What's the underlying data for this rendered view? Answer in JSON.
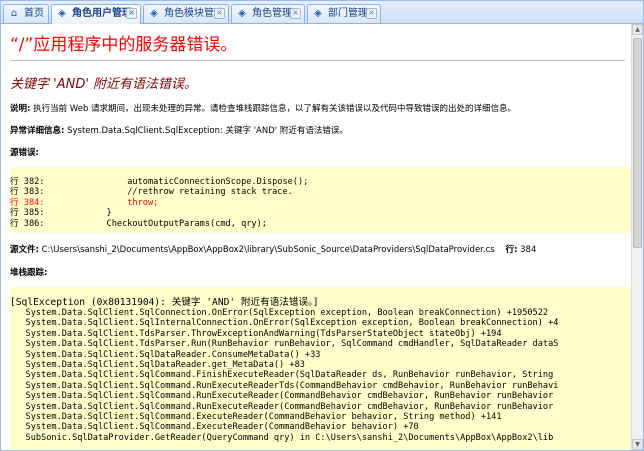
{
  "tabs": [
    {
      "label": "首页",
      "icon": "home-icon",
      "closable": false
    },
    {
      "label": "角色用户管理",
      "icon": "tag-icon",
      "closable": true,
      "active": true
    },
    {
      "label": "角色模块管理",
      "icon": "tag-icon",
      "closable": true
    },
    {
      "label": "角色管理",
      "icon": "tag-icon",
      "closable": true
    },
    {
      "label": "部门管理",
      "icon": "tag-icon",
      "closable": true
    }
  ],
  "error": {
    "title": "“/”应用程序中的服务器错误。",
    "subtitle": "关键字 'AND' 附近有语法错误。",
    "description_label": "说明:",
    "description_text": "执行当前 Web 请求期间，出现未处理的异常。请检查堆栈跟踪信息，以了解有关该错误以及代码中导致错误的出处的详细信息。",
    "exception_label": "异常详细信息:",
    "exception_text": "System.Data.SqlClient.SqlException: 关键字 'AND' 附近有语法错误。",
    "source_error_label": "源错误:",
    "source_lines": [
      {
        "text": "行 382:                automaticConnectionScope.Dispose();",
        "error": false
      },
      {
        "text": "行 383:                //rethrow retaining stack trace.",
        "error": false
      },
      {
        "text": "行 384:                throw;",
        "error": true
      },
      {
        "text": "行 385:            }",
        "error": false
      },
      {
        "text": "行 386:            CheckoutOutputParams(cmd, qry);",
        "error": false
      }
    ],
    "source_file_label": "源文件:",
    "source_file_path": "C:\\Users\\sanshi_2\\Documents\\AppBox\\AppBox2\\library\\SubSonic_Source\\DataProviders\\SqlDataProvider.cs",
    "source_line_label": "行:",
    "source_line_number": "384",
    "stack_label": "堆栈跟踪:",
    "stack_lines": [
      "[SqlException (0x80131904): 关键字 'AND' 附近有语法错误。]",
      "   System.Data.SqlClient.SqlConnection.OnError(SqlException exception, Boolean breakConnection) +1950522",
      "   System.Data.SqlClient.SqlInternalConnection.OnError(SqlException exception, Boolean breakConnection) +4",
      "   System.Data.SqlClient.TdsParser.ThrowExceptionAndWarning(TdsParserStateObject stateObj) +194",
      "   System.Data.SqlClient.TdsParser.Run(RunBehavior runBehavior, SqlCommand cmdHandler, SqlDataReader dataS",
      "   System.Data.SqlClient.SqlDataReader.ConsumeMetaData() +33",
      "   System.Data.SqlClient.SqlDataReader.get_MetaData() +83",
      "   System.Data.SqlClient.SqlCommand.FinishExecuteReader(SqlDataReader ds, RunBehavior runBehavior, String",
      "   System.Data.SqlClient.SqlCommand.RunExecuteReaderTds(CommandBehavior cmdBehavior, RunBehavior runBehavi",
      "   System.Data.SqlClient.SqlCommand.RunExecuteReader(CommandBehavior cmdBehavior, RunBehavior runBehavior",
      "   System.Data.SqlClient.SqlCommand.RunExecuteReader(CommandBehavior cmdBehavior, RunBehavior runBehavior",
      "   System.Data.SqlClient.SqlCommand.ExecuteReader(CommandBehavior behavior, String method) +141",
      "   System.Data.SqlClient.SqlCommand.ExecuteReader(CommandBehavior behavior) +70",
      "   SubSonic.SqlDataProvider.GetReader(QueryCommand qry) in C:\\Users\\sanshi_2\\Documents\\AppBox\\AppBox2\\lib"
    ]
  }
}
